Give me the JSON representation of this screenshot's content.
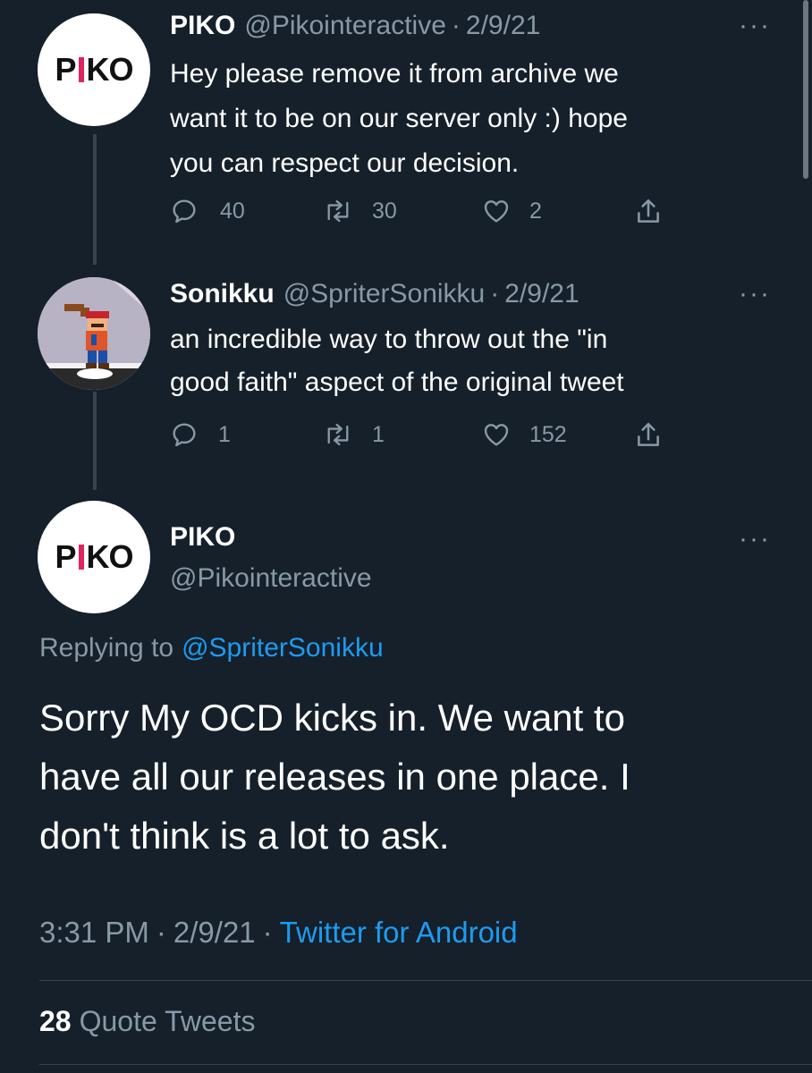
{
  "tweet1": {
    "display_name": "PIKO",
    "handle": "@Pikointeractive",
    "separator": "·",
    "date": "2/9/21",
    "text_lines": [
      "Hey please remove it from archive we",
      "want it to be on our server only :) hope",
      "you can respect our decision."
    ],
    "replies": "40",
    "retweets": "30",
    "likes": "2"
  },
  "tweet2": {
    "display_name": "Sonikku",
    "handle": "@SpriterSonikku",
    "separator": "·",
    "date": "2/9/21",
    "text_lines": [
      "an incredible way to throw out the \"in",
      "good faith\" aspect of the original tweet"
    ],
    "replies": "1",
    "retweets": "1",
    "likes": "152"
  },
  "main_tweet": {
    "display_name": "PIKO",
    "handle": "@Pikointeractive",
    "replying_prefix": "Replying to",
    "replying_to": "@SpriterSonikku",
    "text_lines": [
      "Sorry My OCD kicks in. We want to",
      "have all our releases in one place. I",
      "don't think is a lot to ask."
    ],
    "time": "3:31 PM",
    "date": "2/9/21",
    "separator": "·",
    "source": "Twitter for Android",
    "quote_count": "28",
    "quote_label": "Quote Tweets"
  },
  "logo_text": {
    "p": "P",
    "ko": "KO"
  },
  "colors": {
    "background": "#15202b",
    "muted": "#8899a6",
    "link": "#1d9bf0",
    "logo_accent": "#e0245e"
  },
  "icons": [
    "reply-icon",
    "retweet-icon",
    "like-icon",
    "share-icon",
    "more-icon"
  ]
}
